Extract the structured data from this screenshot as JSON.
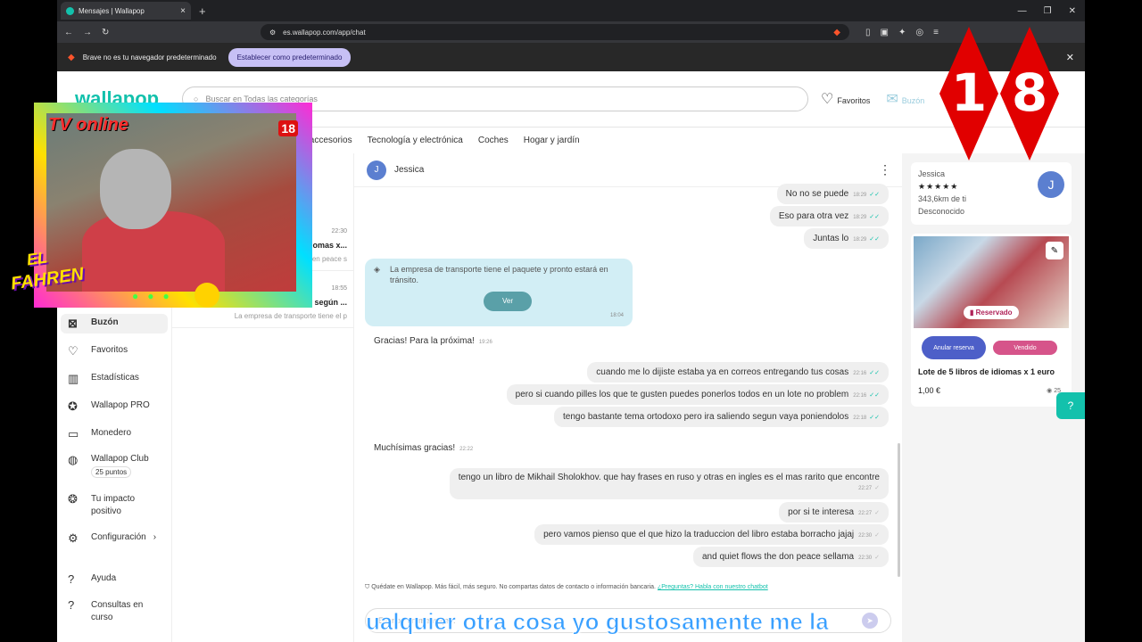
{
  "browser": {
    "tab_title": "Mensajes | Wallapop",
    "url": "es.wallapop.com/app/chat",
    "infobar_text": "Brave no es tu navegador predeterminado",
    "infobar_button": "Establecer como predeterminado"
  },
  "header": {
    "logo": "wallapop",
    "search_placeholder": "Buscar en Todas las categorías",
    "favoritos": "Favoritos",
    "buzon": "Buzón"
  },
  "categories": [
    "y accesorios",
    "Tecnología y electrónica",
    "Coches",
    "Hogar y jardín"
  ],
  "sidebar": [
    {
      "label": "Buzón",
      "icon": "inbox-icon"
    },
    {
      "label": "Favoritos",
      "icon": "heart-icon"
    },
    {
      "label": "Estadísticas",
      "icon": "stats-icon"
    },
    {
      "label": "Wallapop PRO",
      "icon": "pro-badge-icon"
    },
    {
      "label": "Monedero",
      "icon": "wallet-icon"
    },
    {
      "label": "Wallapop Club",
      "icon": "globe-icon",
      "extra": "25 puntos"
    },
    {
      "label": "Tu impacto positivo",
      "icon": "leaf-icon"
    },
    {
      "label": "Configuración",
      "icon": "gear-icon"
    },
    {
      "label": "Ayuda",
      "icon": "help-icon"
    },
    {
      "label": "Consultas en curso",
      "icon": "question-icon"
    }
  ],
  "conversations": [
    {
      "time": "22:30",
      "name": "omas x...",
      "preview": "en peace s"
    },
    {
      "time": "18:55",
      "name": "según ...",
      "preview": "La empresa de transporte tiene el p"
    }
  ],
  "chat": {
    "contact": "Jessica",
    "avatar_letter": "J",
    "messages": [
      {
        "text": "No no se puede",
        "time": "18:29",
        "me": true
      },
      {
        "text": "Eso para otra vez",
        "time": "18:29",
        "me": true
      },
      {
        "text": "Juntas lo",
        "time": "18:29",
        "me": true
      },
      {
        "text": "Gracias! Para la próxima!",
        "time": "19:26",
        "me": false
      },
      {
        "text": "cuando me lo dijiste estaba ya en correos entregando tus cosas",
        "time": "22:16",
        "me": true
      },
      {
        "text": "pero si cuando pilles los que te gusten puedes ponerlos todos en un lote no problem",
        "time": "22:16",
        "me": true
      },
      {
        "text": "tengo bastante tema ortodoxo pero ira saliendo segun vaya poniendolos",
        "time": "22:18",
        "me": true
      },
      {
        "text": "Muchísimas gracias!",
        "time": "22:22",
        "me": false
      },
      {
        "text": "tengo un libro de Mikhail Sholokhov. que hay frases en ruso y otras en ingles es el mas rarito que encontre",
        "time": "22:27",
        "me": true
      },
      {
        "text": "por si te interesa",
        "time": "22:27",
        "me": true
      },
      {
        "text": "pero vamos pienso que el que hizo la traduccion del libro estaba borracho jajaj",
        "time": "22:30",
        "me": true
      },
      {
        "text": "and quiet flows the don  peace sellama",
        "time": "22:30",
        "me": true
      }
    ],
    "notice_text": "La empresa de transporte tiene el paquete y pronto estará en tránsito.",
    "notice_button": "Ver",
    "notice_time": "18:04",
    "safety_text": "Quédate en Wallapop. Más fácil, más seguro. No compartas datos de contacto o información bancaria.",
    "safety_link": "¿Preguntas? Habla con nuestro chatbot",
    "composer_placeholder": "Escribe un mensaje..."
  },
  "right_panel": {
    "user_name": "Jessica",
    "stars": "★★★★★",
    "distance": "343,6km de ti",
    "status": "Desconocido",
    "reserved_badge": "Reservado",
    "btn_cancel": "Anular reserva",
    "btn_sold": "Vendido",
    "product_title": "Lote de 5 libros de idiomas x 1 euro",
    "price": "1,00 €",
    "views": "25"
  },
  "overlay": {
    "tv_online": "TV online",
    "fahren_1": "EL",
    "fahren_2": "FAHREN",
    "rating_1": "1",
    "rating_2": "8",
    "small_rating": "18",
    "subtitle": "ualquier otra cosa yo gustosamente me la"
  },
  "colors": {
    "accent": "#13c1ac",
    "reserved": "#b0255a",
    "sold": "#d6548a",
    "cancel": "#4d5fc8",
    "rating": "#e10000"
  }
}
